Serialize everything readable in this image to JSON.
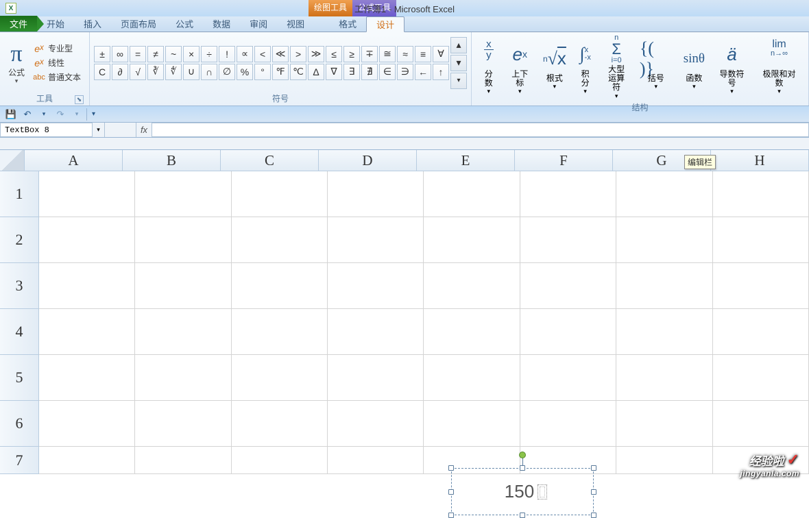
{
  "title": "工作簿1 - Microsoft Excel",
  "contextual": {
    "drawing": "绘图工具",
    "formula": "公式工具"
  },
  "tabs": {
    "file": "文件",
    "home": "开始",
    "insert": "插入",
    "layout": "页面布局",
    "formulas": "公式",
    "data": "数据",
    "review": "审阅",
    "view": "视图",
    "format": "格式",
    "design": "设计"
  },
  "ribbon": {
    "tools": {
      "formula": "公式",
      "pro": "专业型",
      "linear": "线性",
      "plain": "普通文本",
      "label": "工具"
    },
    "symbols": {
      "row1": [
        "±",
        "∞",
        "=",
        "≠",
        "~",
        "×",
        "÷",
        "!",
        "∝",
        "<",
        "≪",
        ">",
        "≫",
        "≤",
        "≥",
        "∓",
        "≅",
        "≈",
        "≡",
        "∀"
      ],
      "row2": [
        "C",
        "∂",
        "√",
        "∛",
        "∜",
        "∪",
        "∩",
        "∅",
        "%",
        "°",
        "℉",
        "℃",
        "∆",
        "∇",
        "∃",
        "∄",
        "∈",
        "∋",
        "←",
        "↑"
      ],
      "label": "符号"
    },
    "structures": {
      "fraction": "分数",
      "script": "上下标",
      "radical": "根式",
      "integral": "积分",
      "large": "大型\n运算符",
      "bracket": "括号",
      "func": "函数",
      "deriv": "导数符号",
      "limit": "极限和对数",
      "label": "结构"
    }
  },
  "nameBox": "TextBox 8",
  "tooltip": "编辑栏",
  "columns": [
    "A",
    "B",
    "C",
    "D",
    "E",
    "F",
    "G",
    "H"
  ],
  "rows": [
    "1",
    "2",
    "3",
    "4",
    "5",
    "6",
    "7"
  ],
  "textbox_value": "150",
  "watermark": {
    "line1": "经验啦",
    "site": "jingyanla.com"
  }
}
